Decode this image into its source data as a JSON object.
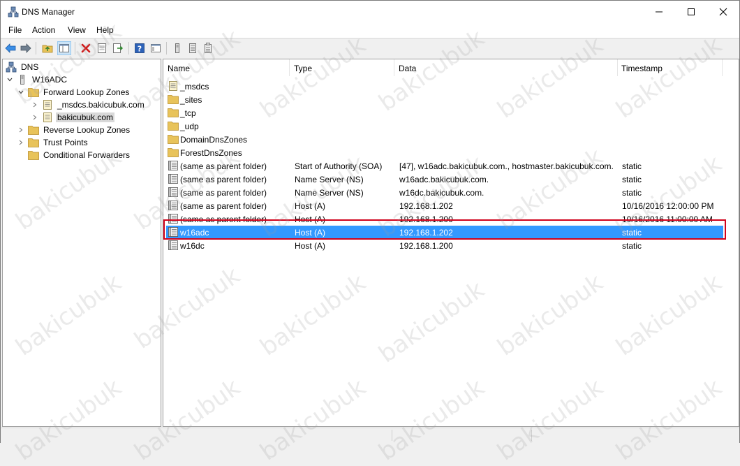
{
  "window": {
    "title": "DNS Manager",
    "controls": {
      "minimize": "—",
      "maximize": "☐",
      "close": "✕"
    }
  },
  "menu": {
    "items": [
      "File",
      "Action",
      "View",
      "Help"
    ]
  },
  "toolbar": {
    "buttons": [
      "back-arrow-icon",
      "forward-arrow-icon",
      "up-folder-icon",
      "show-hide-tree-icon",
      "delete-icon",
      "properties-icon",
      "export-list-icon",
      "help-icon",
      "console-tree-icon",
      "server-icon",
      "zone-icon",
      "record-icon"
    ]
  },
  "tree": {
    "root": "DNS",
    "server": "W16ADC",
    "forward": "Forward Lookup Zones",
    "msdcs": "_msdcs.bakicubuk.com",
    "zone": "bakicubuk.com",
    "reverse": "Reverse Lookup Zones",
    "trust": "Trust Points",
    "conditional": "Conditional Forwarders"
  },
  "list": {
    "columns": [
      "Name",
      "Type",
      "Data",
      "Timestamp"
    ],
    "rows": [
      {
        "icon": "zone-file",
        "name": "_msdcs",
        "type": "",
        "data": "",
        "timestamp": ""
      },
      {
        "icon": "folder",
        "name": "_sites",
        "type": "",
        "data": "",
        "timestamp": ""
      },
      {
        "icon": "folder",
        "name": "_tcp",
        "type": "",
        "data": "",
        "timestamp": ""
      },
      {
        "icon": "folder",
        "name": "_udp",
        "type": "",
        "data": "",
        "timestamp": ""
      },
      {
        "icon": "folder",
        "name": "DomainDnsZones",
        "type": "",
        "data": "",
        "timestamp": ""
      },
      {
        "icon": "folder",
        "name": "ForestDnsZones",
        "type": "",
        "data": "",
        "timestamp": ""
      },
      {
        "icon": "record",
        "name": "(same as parent folder)",
        "type": "Start of Authority (SOA)",
        "data": "[47], w16adc.bakicubuk.com., hostmaster.bakicubuk.com.",
        "timestamp": "static"
      },
      {
        "icon": "record",
        "name": "(same as parent folder)",
        "type": "Name Server (NS)",
        "data": "w16adc.bakicubuk.com.",
        "timestamp": "static"
      },
      {
        "icon": "record",
        "name": "(same as parent folder)",
        "type": "Name Server (NS)",
        "data": "w16dc.bakicubuk.com.",
        "timestamp": "static"
      },
      {
        "icon": "record",
        "name": "(same as parent folder)",
        "type": "Host (A)",
        "data": "192.168.1.202",
        "timestamp": "10/16/2016 12:00:00 PM"
      },
      {
        "icon": "record",
        "name": "(same as parent folder)",
        "type": "Host (A)",
        "data": "192.168.1.200",
        "timestamp": "10/16/2016 11:00:00 AM"
      },
      {
        "icon": "record",
        "name": "w16adc",
        "type": "Host (A)",
        "data": "192.168.1.202",
        "timestamp": "static",
        "selected": true
      },
      {
        "icon": "record",
        "name": "w16dc",
        "type": "Host (A)",
        "data": "192.168.1.200",
        "timestamp": "static"
      }
    ]
  },
  "watermark": "bakicubuk",
  "colors": {
    "selection": "#3399ff",
    "highlight_box": "#d0021b",
    "folder": "#e8c35a"
  }
}
